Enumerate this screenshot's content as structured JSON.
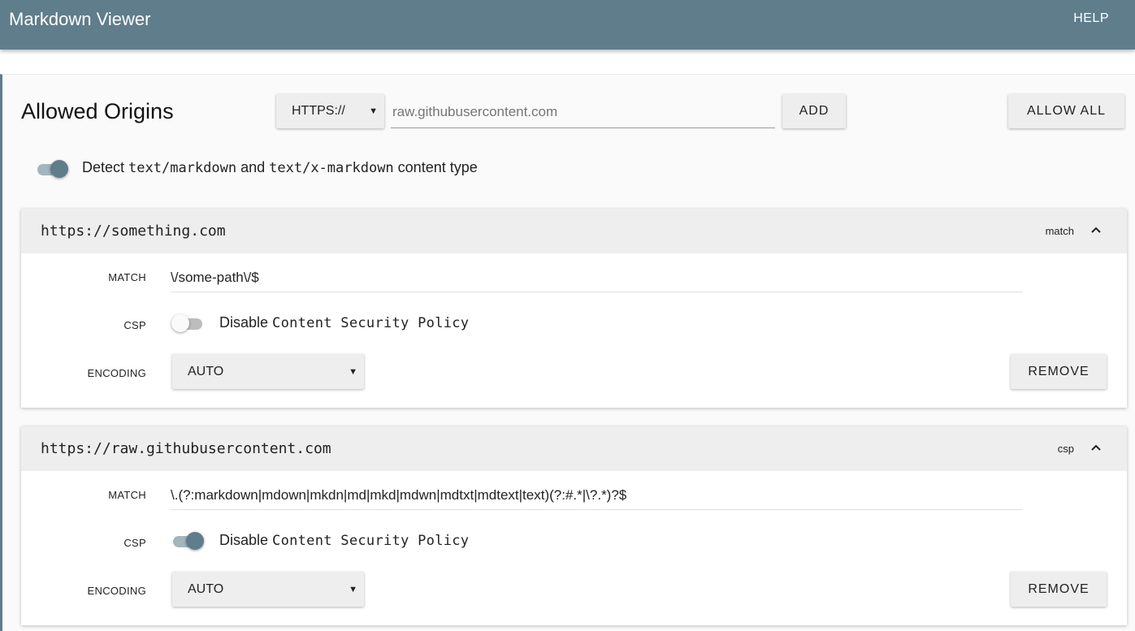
{
  "app": {
    "title": "Markdown Viewer",
    "help_label": "HELP"
  },
  "origins": {
    "heading": "Allowed Origins",
    "scheme_select": {
      "value": "HTTPS://"
    },
    "origin_input": {
      "placeholder": "raw.githubusercontent.com"
    },
    "add_label": "ADD",
    "allow_all_label": "ALLOW ALL",
    "detect": {
      "enabled": true,
      "prefix": "Detect ",
      "type1": "text/markdown",
      "middle": " and ",
      "type2": "text/x-markdown",
      "suffix": " content type"
    }
  },
  "labels": {
    "match": "MATCH",
    "csp": "CSP",
    "encoding": "ENCODING",
    "remove": "REMOVE"
  },
  "cards": [
    {
      "origin": "https://something.com",
      "tag": "match",
      "match_value": "\\/some-path\\/$",
      "csp_enabled": false,
      "csp_prefix": "Disable ",
      "csp_mono": "Content Security Policy",
      "encoding": "AUTO"
    },
    {
      "origin": "https://raw.githubusercontent.com",
      "tag": "csp",
      "match_value": "\\.(?:markdown|mdown|mkdn|md|mkd|mdwn|mdtxt|mdtext|text)(?:#.*|\\?.*)?$",
      "csp_enabled": true,
      "csp_prefix": "Disable ",
      "csp_mono": "Content Security Policy",
      "encoding": "AUTO"
    }
  ],
  "colors": {
    "primary": "#607d8b",
    "toggle_track_on": "#a3b5be",
    "header_bg": "#eeeeee"
  },
  "icons": {
    "chevron": "chevron-up-icon",
    "dropdown": "dropdown-arrow-icon"
  }
}
